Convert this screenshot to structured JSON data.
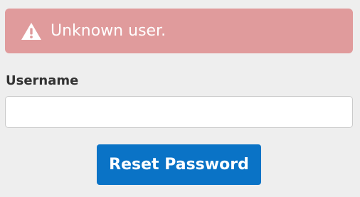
{
  "alert": {
    "icon": "warning-triangle-icon",
    "message": "Unknown user.",
    "background_color": "#e09b9c"
  },
  "form": {
    "username_label": "Username",
    "username_value": "",
    "username_placeholder": "",
    "reset_button_label": "Reset Password",
    "button_color": "#0a73c6"
  }
}
